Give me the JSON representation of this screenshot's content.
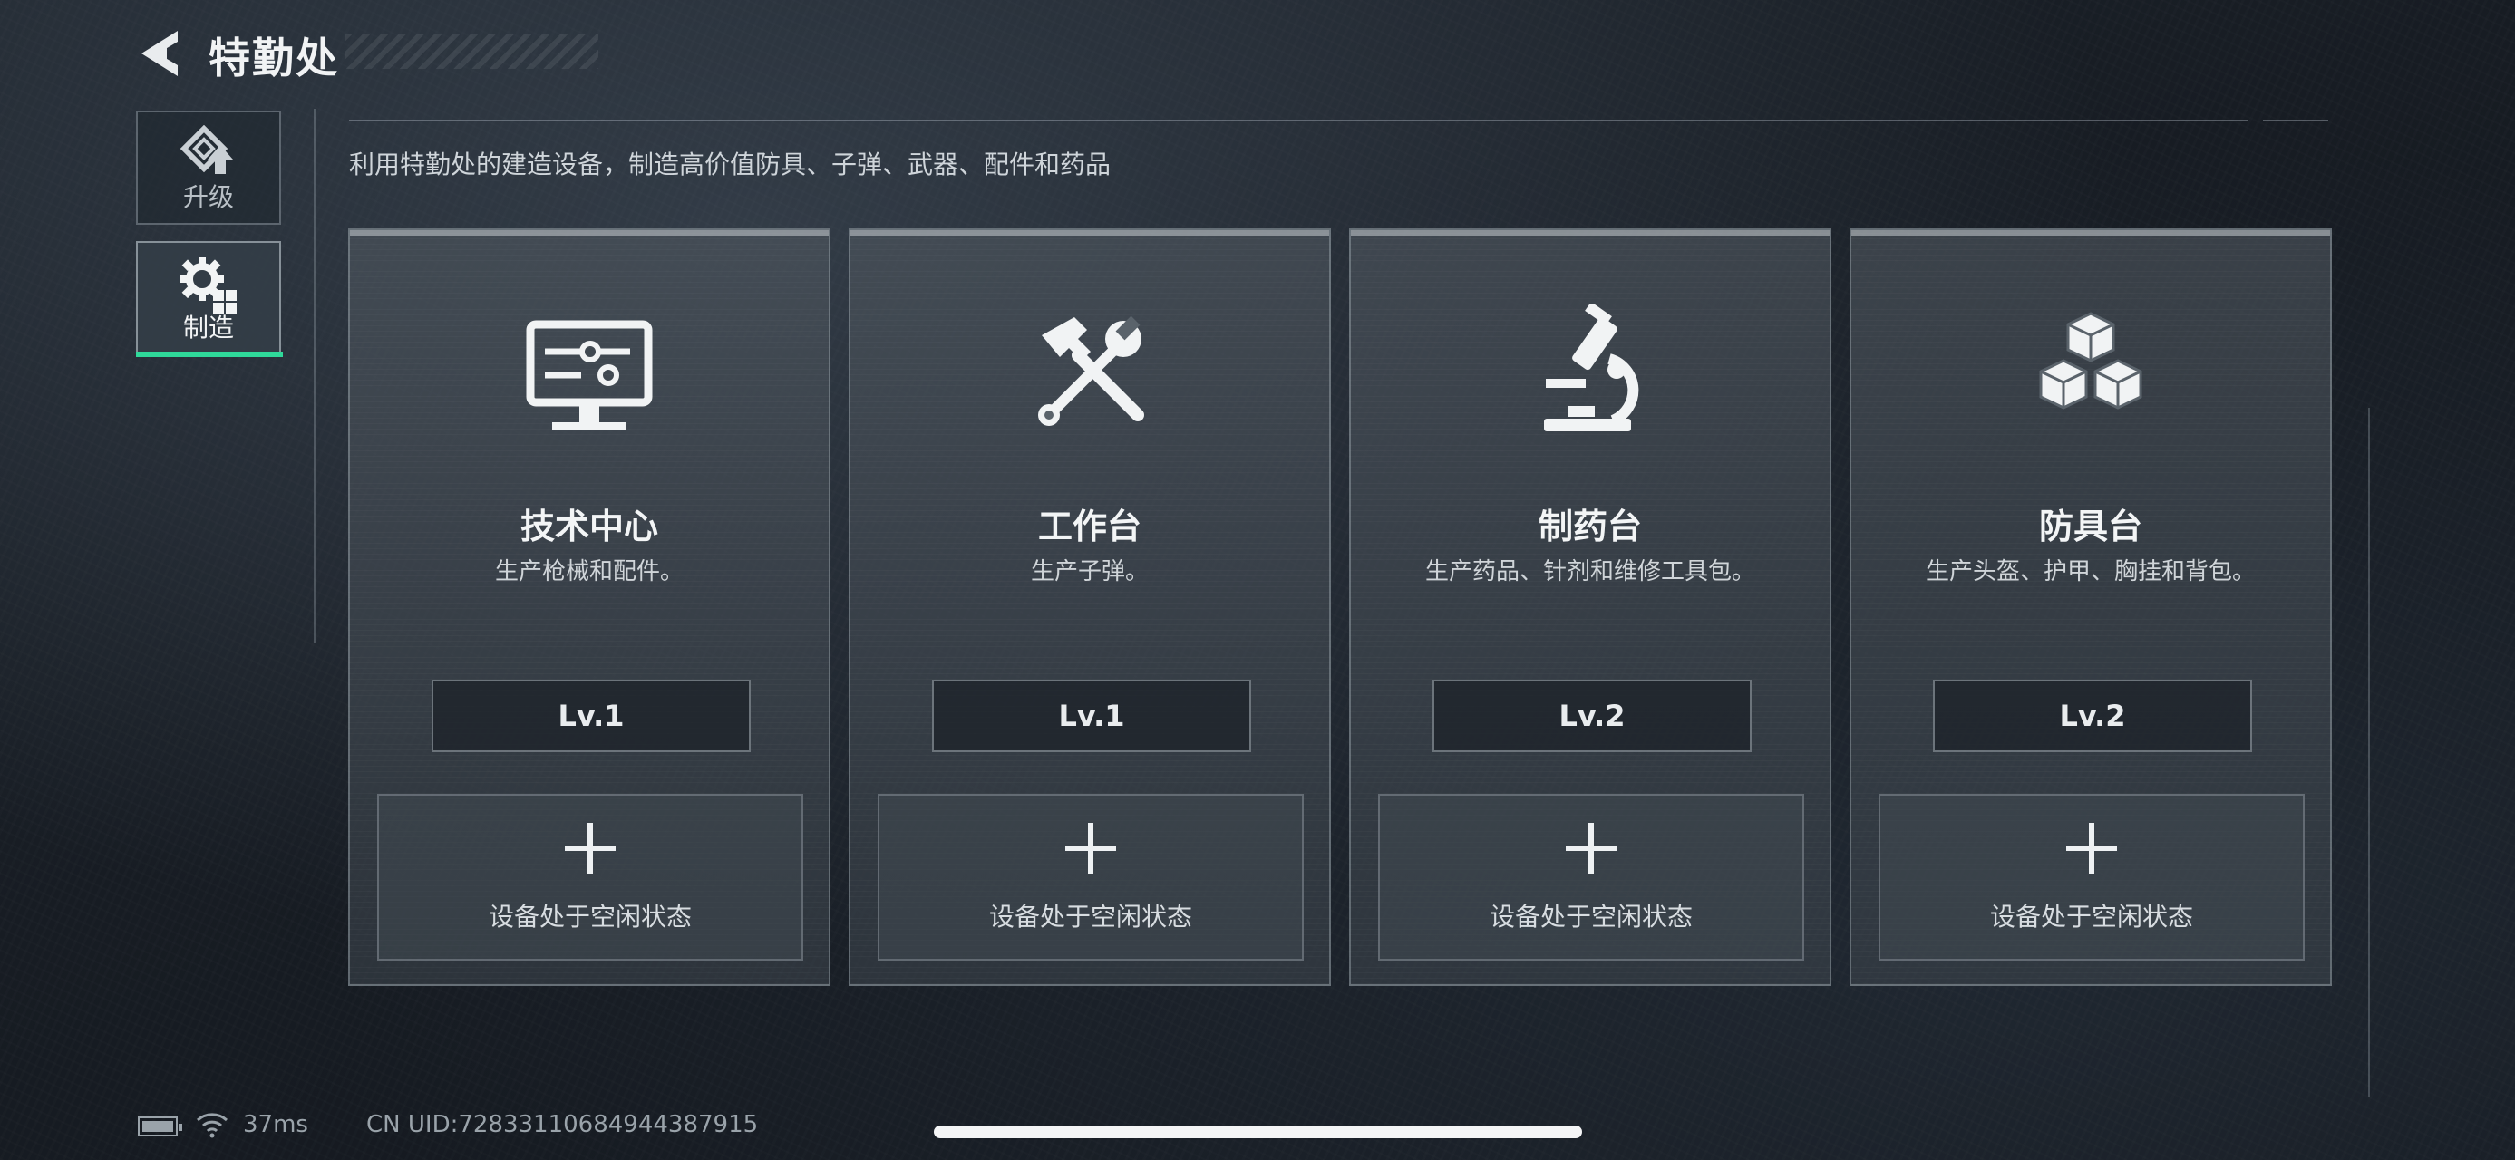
{
  "header": {
    "title": "特勤处"
  },
  "sidebar": {
    "items": [
      {
        "label": "升级",
        "icon": "upgrade-icon"
      },
      {
        "label": "制造",
        "icon": "craft-gear-icon",
        "active": true
      }
    ],
    "active_color": "#2fd99a"
  },
  "description": "利用特勤处的建造设备，制造高价值防具、子弹、武器、配件和药品",
  "cards": [
    {
      "title": "技术中心",
      "subtitle": "生产枪械和配件。",
      "level": "Lv.1",
      "slot_text": "设备处于空闲状态",
      "icon": "monitor-icon"
    },
    {
      "title": "工作台",
      "subtitle": "生产子弹。",
      "level": "Lv.1",
      "slot_text": "设备处于空闲状态",
      "icon": "hammer-wrench-icon"
    },
    {
      "title": "制药台",
      "subtitle": "生产药品、针剂和维修工具包。",
      "level": "Lv.2",
      "slot_text": "设备处于空闲状态",
      "icon": "microscope-icon"
    },
    {
      "title": "防具台",
      "subtitle": "生产头盔、护甲、胸挂和背包。",
      "level": "Lv.2",
      "slot_text": "设备处于空闲状态",
      "icon": "cubes-icon"
    }
  ],
  "status_bar": {
    "ping": "37ms",
    "uid": "CN UID:72833110684944387915"
  }
}
